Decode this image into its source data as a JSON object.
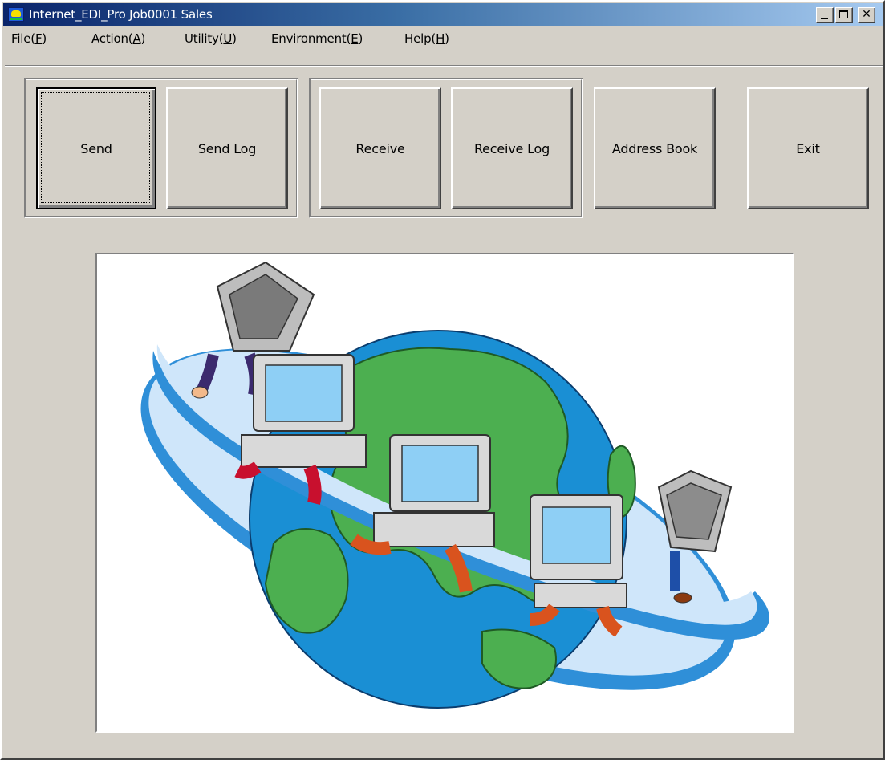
{
  "window": {
    "title": "Internet_EDI_Pro Job0001 Sales",
    "icon": "app-icon",
    "controls": [
      "minimize-icon",
      "maximize-icon",
      "close-icon"
    ],
    "close_glyph": "✕"
  },
  "menu": {
    "items": [
      {
        "label": "File(",
        "key": "F",
        "suffix": ")"
      },
      {
        "label": "Action(",
        "key": "A",
        "suffix": ")"
      },
      {
        "label": "Utility(",
        "key": "U",
        "suffix": ")"
      },
      {
        "label": "Environment(",
        "key": "E",
        "suffix": ")"
      },
      {
        "label": "Help(",
        "key": "H",
        "suffix": ")"
      }
    ]
  },
  "toolbar": {
    "send": "Send",
    "send_log": "Send Log",
    "receive": "Receive",
    "receive_log": "Receive Log",
    "address_book": "Address Book",
    "exit": "Exit",
    "focused_button": "Send"
  },
  "illustration": {
    "subject": "globe-with-walking-computers",
    "colors": {
      "ocean": "#1a8fd4",
      "land": "#4caf50",
      "ring": "#cfe6fa",
      "ring_edge": "#2f8fd8",
      "computer": "#d9d9d9",
      "screen": "#8ecff5",
      "pants_red": "#c8102e",
      "pants_orange": "#d9531e",
      "pants_purple": "#3b2a6e",
      "pants_blue": "#1e4fa8"
    }
  },
  "theme": {
    "face": "#d4d0c8",
    "title_start": "#0a246a",
    "title_end": "#a6caf0"
  }
}
